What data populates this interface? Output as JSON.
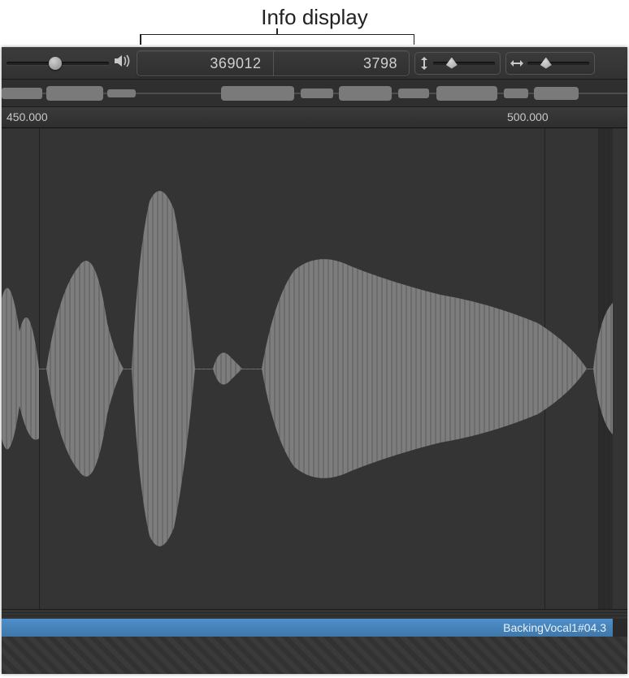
{
  "callout": {
    "label": "Info display"
  },
  "info": {
    "position": "369012",
    "length": "3798"
  },
  "ruler": {
    "ticks": [
      "450.000",
      "500.000"
    ]
  },
  "region": {
    "name": "BackingVocal1#04.3"
  },
  "icons": {
    "volume": "volume-icon",
    "vzoom": "vertical-zoom-icon",
    "hzoom": "horizontal-zoom-icon"
  },
  "colors": {
    "region": "#4f8fca",
    "waveform": "#7d7d7d",
    "bg": "#343434"
  }
}
